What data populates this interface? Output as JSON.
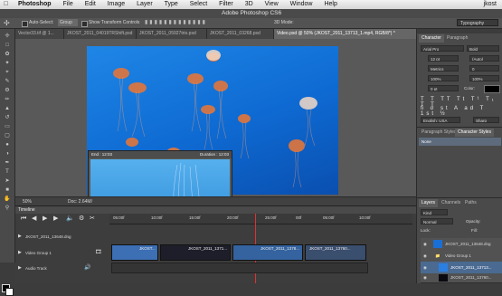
{
  "menubar": {
    "apple": "",
    "app": "Photoshop",
    "menus": [
      "File",
      "Edit",
      "Image",
      "Layer",
      "Type",
      "Select",
      "Filter",
      "3D",
      "View",
      "Window",
      "Help"
    ],
    "user": "jkost"
  },
  "window": {
    "title": "Adobe Photoshop CS6"
  },
  "options_bar": {
    "auto_select_label": "Auto-Select:",
    "auto_select_value": "Group",
    "transform_label": "Show Transform Controls",
    "mode_3d": "3D Mode:",
    "workspace": "Typography"
  },
  "doc_tabs": [
    "Vector33.tif @ 1...",
    "JKOST_2011_04019TRShift.psd",
    "JKOST_2011_05927trio.psd",
    "JKOST_2011_03268.psd",
    "Video.psd @ 50% (JKOST_2011_13713_1.mp4, RGB/8*) *"
  ],
  "canvas": {
    "clip_preview": {
      "end_label": "End : 12:03",
      "duration_label": "Duration : 12:03"
    }
  },
  "status": {
    "zoom": "50%",
    "doc": "Doc: 2.64M/"
  },
  "timeline": {
    "title": "Timeline",
    "time_marks": [
      "05:00f",
      "10:00f",
      "15:00f",
      "20:00f",
      "25:00f",
      "00f",
      "05:00f",
      "10:00f"
    ],
    "tracks": [
      {
        "label": "JKOST_2011_13648.dng"
      },
      {
        "label": "Video Group 1"
      },
      {
        "label": "Audio Track"
      }
    ],
    "clips": [
      "JKOST...",
      "JKOST_2011_1371...",
      "JKOST_2011_1378...",
      "JKOST_2011_13760..."
    ]
  },
  "character_panel": {
    "tabs": [
      "Character",
      "Paragraph"
    ],
    "font": "Arial Pro",
    "style": "Bold",
    "size": "12 pt",
    "leading": "(Auto)",
    "kerning": "Metrics",
    "tracking": "0",
    "vscale": "100%",
    "hscale": "100%",
    "baseline": "0 pt",
    "color_label": "Color:",
    "language": "English: USA",
    "aa": "Sharp"
  },
  "styles_panel": {
    "tabs": [
      "Paragraph Styles",
      "Character Styles"
    ],
    "item": "None"
  },
  "layers_panel": {
    "tabs": [
      "Layers",
      "Channels",
      "Paths"
    ],
    "kind": "Kind",
    "blend": "Normal",
    "opacity_label": "Opacity:",
    "lock_label": "Lock:",
    "fill_label": "Fill:",
    "layers": [
      "JKOST_2011_13648.dng",
      "Video Group 1",
      "JKOST_2011_13713...",
      "JKOST_2011_13760..."
    ]
  },
  "colors": {
    "photo_blue": "#1a7de0",
    "active_tab": "#666666",
    "selected_layer": "#4a6a92",
    "clip_blue": "#3c6fb4"
  }
}
